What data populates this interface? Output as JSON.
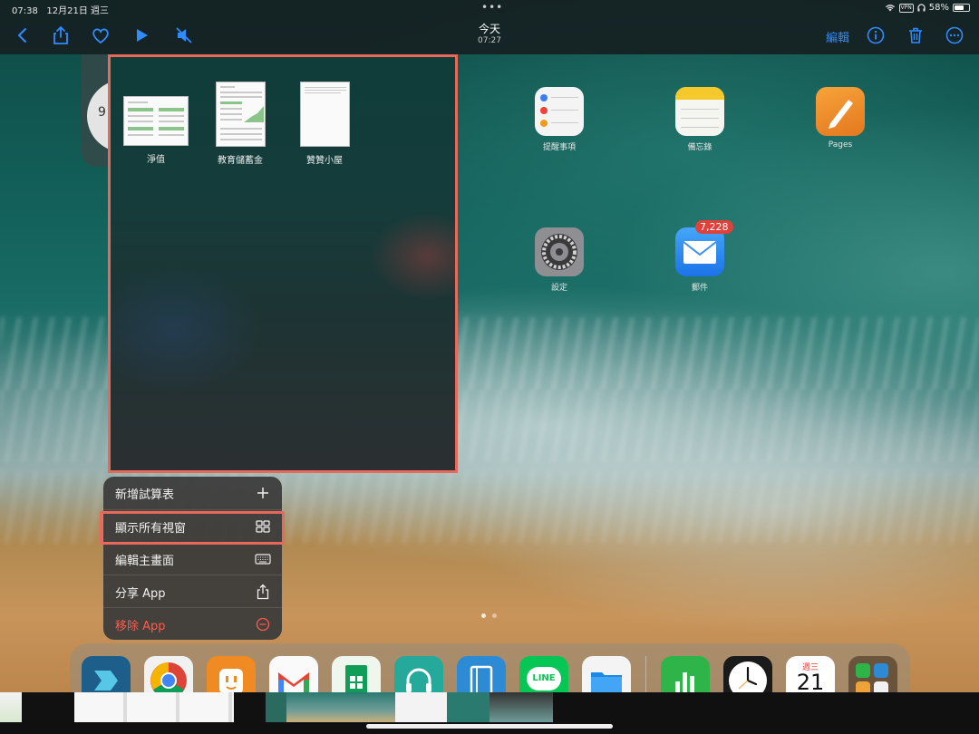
{
  "status_bar": {
    "time": "07:38",
    "date": "12月21日 週三",
    "vpn": "VPN",
    "battery": "58%"
  },
  "toolbar": {
    "title": "今天",
    "subtitle": "07:27",
    "edit_label": "編輯",
    "accent_color": "#2f8bff"
  },
  "home_apps": [
    {
      "label": "提醒事項",
      "icon": "reminders-icon"
    },
    {
      "label": "備忘錄",
      "icon": "notes-icon"
    },
    {
      "label": "Pages",
      "icon": "pages-icon"
    },
    {
      "label": "設定",
      "icon": "settings-icon"
    },
    {
      "label": "郵件",
      "icon": "mail-icon",
      "badge": "7,228"
    }
  ],
  "window_picker": {
    "documents": [
      {
        "label": "淨值"
      },
      {
        "label": "教育儲蓄金"
      },
      {
        "label": "贊贊小屋"
      }
    ]
  },
  "context_menu": {
    "items": [
      {
        "label": "新增試算表",
        "icon": "plus-icon"
      },
      {
        "label": "顯示所有視窗",
        "icon": "grid-icon"
      },
      {
        "label": "編輯主畫面",
        "icon": "keyboard-icon"
      },
      {
        "label": "分享 App",
        "icon": "share-icon"
      },
      {
        "label": "移除 App",
        "icon": "minus-circle-icon",
        "destructive": true
      }
    ]
  },
  "dock": {
    "apps": [
      "shortcuts-icon",
      "chrome-icon",
      "plug-icon",
      "gmail-icon",
      "sheets-icon",
      "headphones-icon",
      "notebook-icon",
      "line-icon",
      "files-icon",
      "numbers-icon",
      "clock-icon",
      "calendar-icon",
      "app-folder-icon"
    ],
    "line_label": "LINE",
    "calendar_weekday": "週三",
    "calendar_day": "21"
  }
}
